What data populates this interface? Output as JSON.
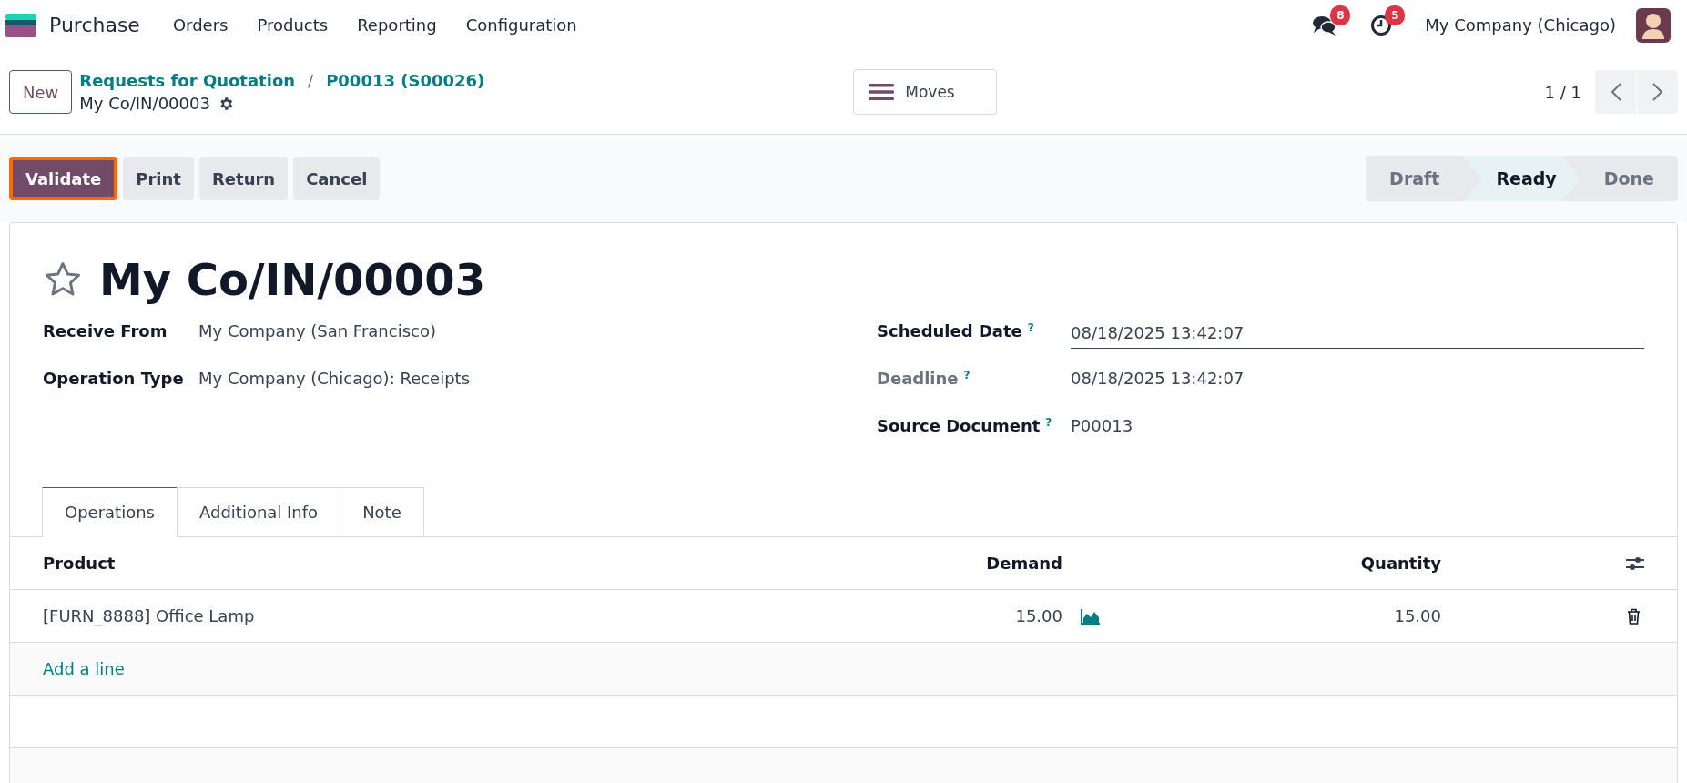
{
  "navbar": {
    "app_name": "Purchase",
    "menu": [
      "Orders",
      "Products",
      "Reporting",
      "Configuration"
    ],
    "messages_count": "8",
    "activities_count": "5",
    "company": "My Company (Chicago)"
  },
  "control_panel": {
    "new_button": "New",
    "breadcrumbs": [
      "Requests for Quotation",
      "P00013 (S00026)"
    ],
    "breadcrumb_separator": "/",
    "record": "My Co/IN/00003",
    "moves_button": "Moves",
    "pager": "1 / 1"
  },
  "actions": [
    {
      "label": "Validate",
      "kind": "primary",
      "highlighted": true
    },
    {
      "label": "Print",
      "kind": "secondary",
      "highlighted": false
    },
    {
      "label": "Return",
      "kind": "secondary",
      "highlighted": false
    },
    {
      "label": "Cancel",
      "kind": "secondary",
      "highlighted": false
    }
  ],
  "statusbar": [
    {
      "label": "Draft",
      "selected": false
    },
    {
      "label": "Ready",
      "selected": true
    },
    {
      "label": "Done",
      "selected": false
    }
  ],
  "form": {
    "title": "My Co/IN/00003",
    "starred": false,
    "left_fields": [
      {
        "label": "Receive From",
        "value": "My Company (San Francisco)",
        "disabled": false
      },
      {
        "label": "Operation Type",
        "value": "My Company (Chicago): Receipts",
        "disabled": false
      }
    ],
    "right_fields": [
      {
        "label": "Scheduled Date",
        "help": "?",
        "value": "08/18/2025 13:42:07",
        "kind": "input",
        "disabled": false
      },
      {
        "label": "Deadline",
        "help": "?",
        "value": "08/18/2025 13:42:07",
        "kind": "text",
        "disabled": true
      },
      {
        "label": "Source Document",
        "help": "?",
        "value": "P00013",
        "kind": "text",
        "disabled": false
      }
    ],
    "tabs": [
      {
        "label": "Operations",
        "selected": true
      },
      {
        "label": "Additional Info",
        "selected": false
      },
      {
        "label": "Note",
        "selected": false
      }
    ],
    "table": {
      "columns": [
        "Product",
        "Demand",
        "Quantity"
      ],
      "rows": [
        {
          "product": "[FURN_8888] Office Lamp",
          "demand": "15.00",
          "quantity": "15.00"
        }
      ],
      "add_line": "Add a line"
    }
  }
}
